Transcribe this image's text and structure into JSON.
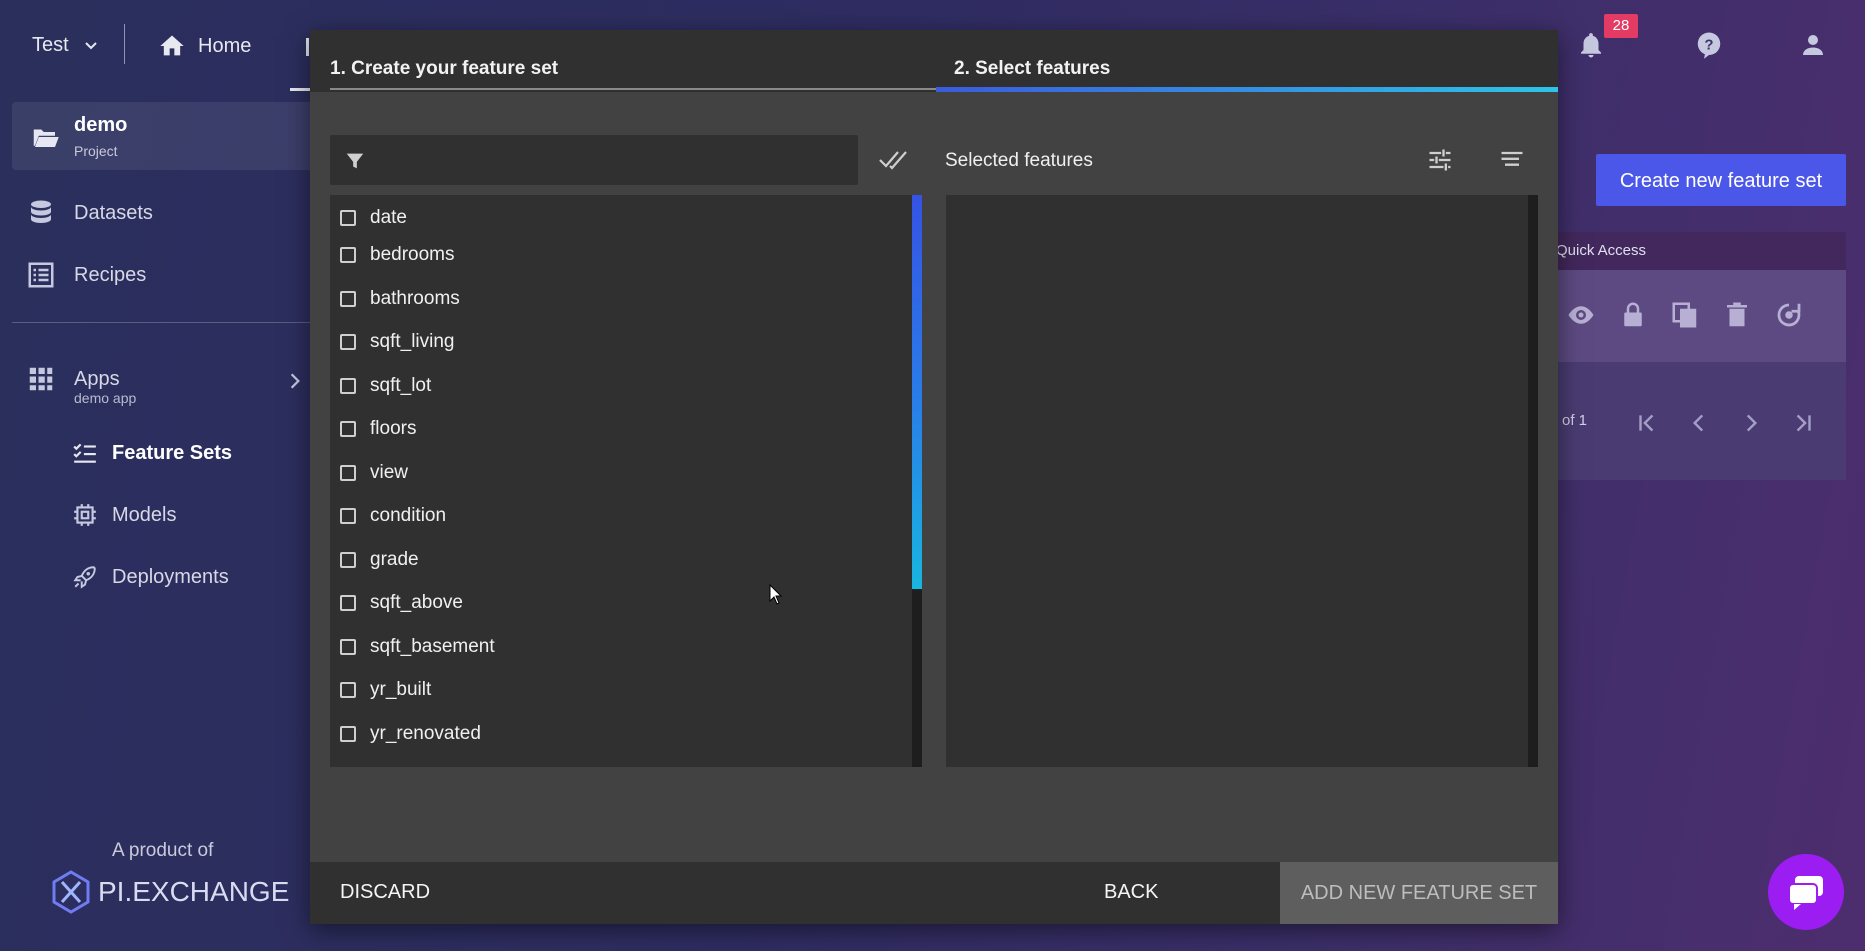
{
  "topbar": {
    "project_selector": "Test",
    "home_label": "Home",
    "notification_count": "28"
  },
  "sidebar": {
    "project": {
      "name": "demo",
      "subtitle": "Project"
    },
    "items": [
      {
        "label": "Datasets",
        "icon": "database-icon"
      },
      {
        "label": "Recipes",
        "icon": "list-icon"
      }
    ],
    "apps": {
      "label": "Apps",
      "subtitle": "demo app"
    },
    "sub_items": [
      {
        "label": "Feature Sets",
        "icon": "checklist-icon",
        "active": true
      },
      {
        "label": "Models",
        "icon": "chip-icon"
      },
      {
        "label": "Deployments",
        "icon": "rocket-icon"
      }
    ],
    "product_of": "A product of",
    "logo_text": "PI.EXCHANGE"
  },
  "background_panel": {
    "create_button": "Create new feature set",
    "quick_access": "Quick Access",
    "pager_text": "of 1"
  },
  "modal": {
    "step1_label": "1. Create your feature set",
    "step2_label": "2. Select features",
    "filter_placeholder": "",
    "selected_title": "Selected features",
    "features": [
      "date",
      "bedrooms",
      "bathrooms",
      "sqft_living",
      "sqft_lot",
      "floors",
      "view",
      "condition",
      "grade",
      "sqft_above",
      "sqft_basement",
      "yr_built",
      "yr_renovated"
    ],
    "discard_label": "DISCARD",
    "back_label": "BACK",
    "add_label": "ADD NEW FEATURE SET"
  },
  "colors": {
    "accent": "#4b57e8",
    "badge": "#e33b64",
    "step_gradient_start": "#3b5bdb",
    "step_gradient_end": "#2ec4e8",
    "chat": "#9b1df2"
  }
}
